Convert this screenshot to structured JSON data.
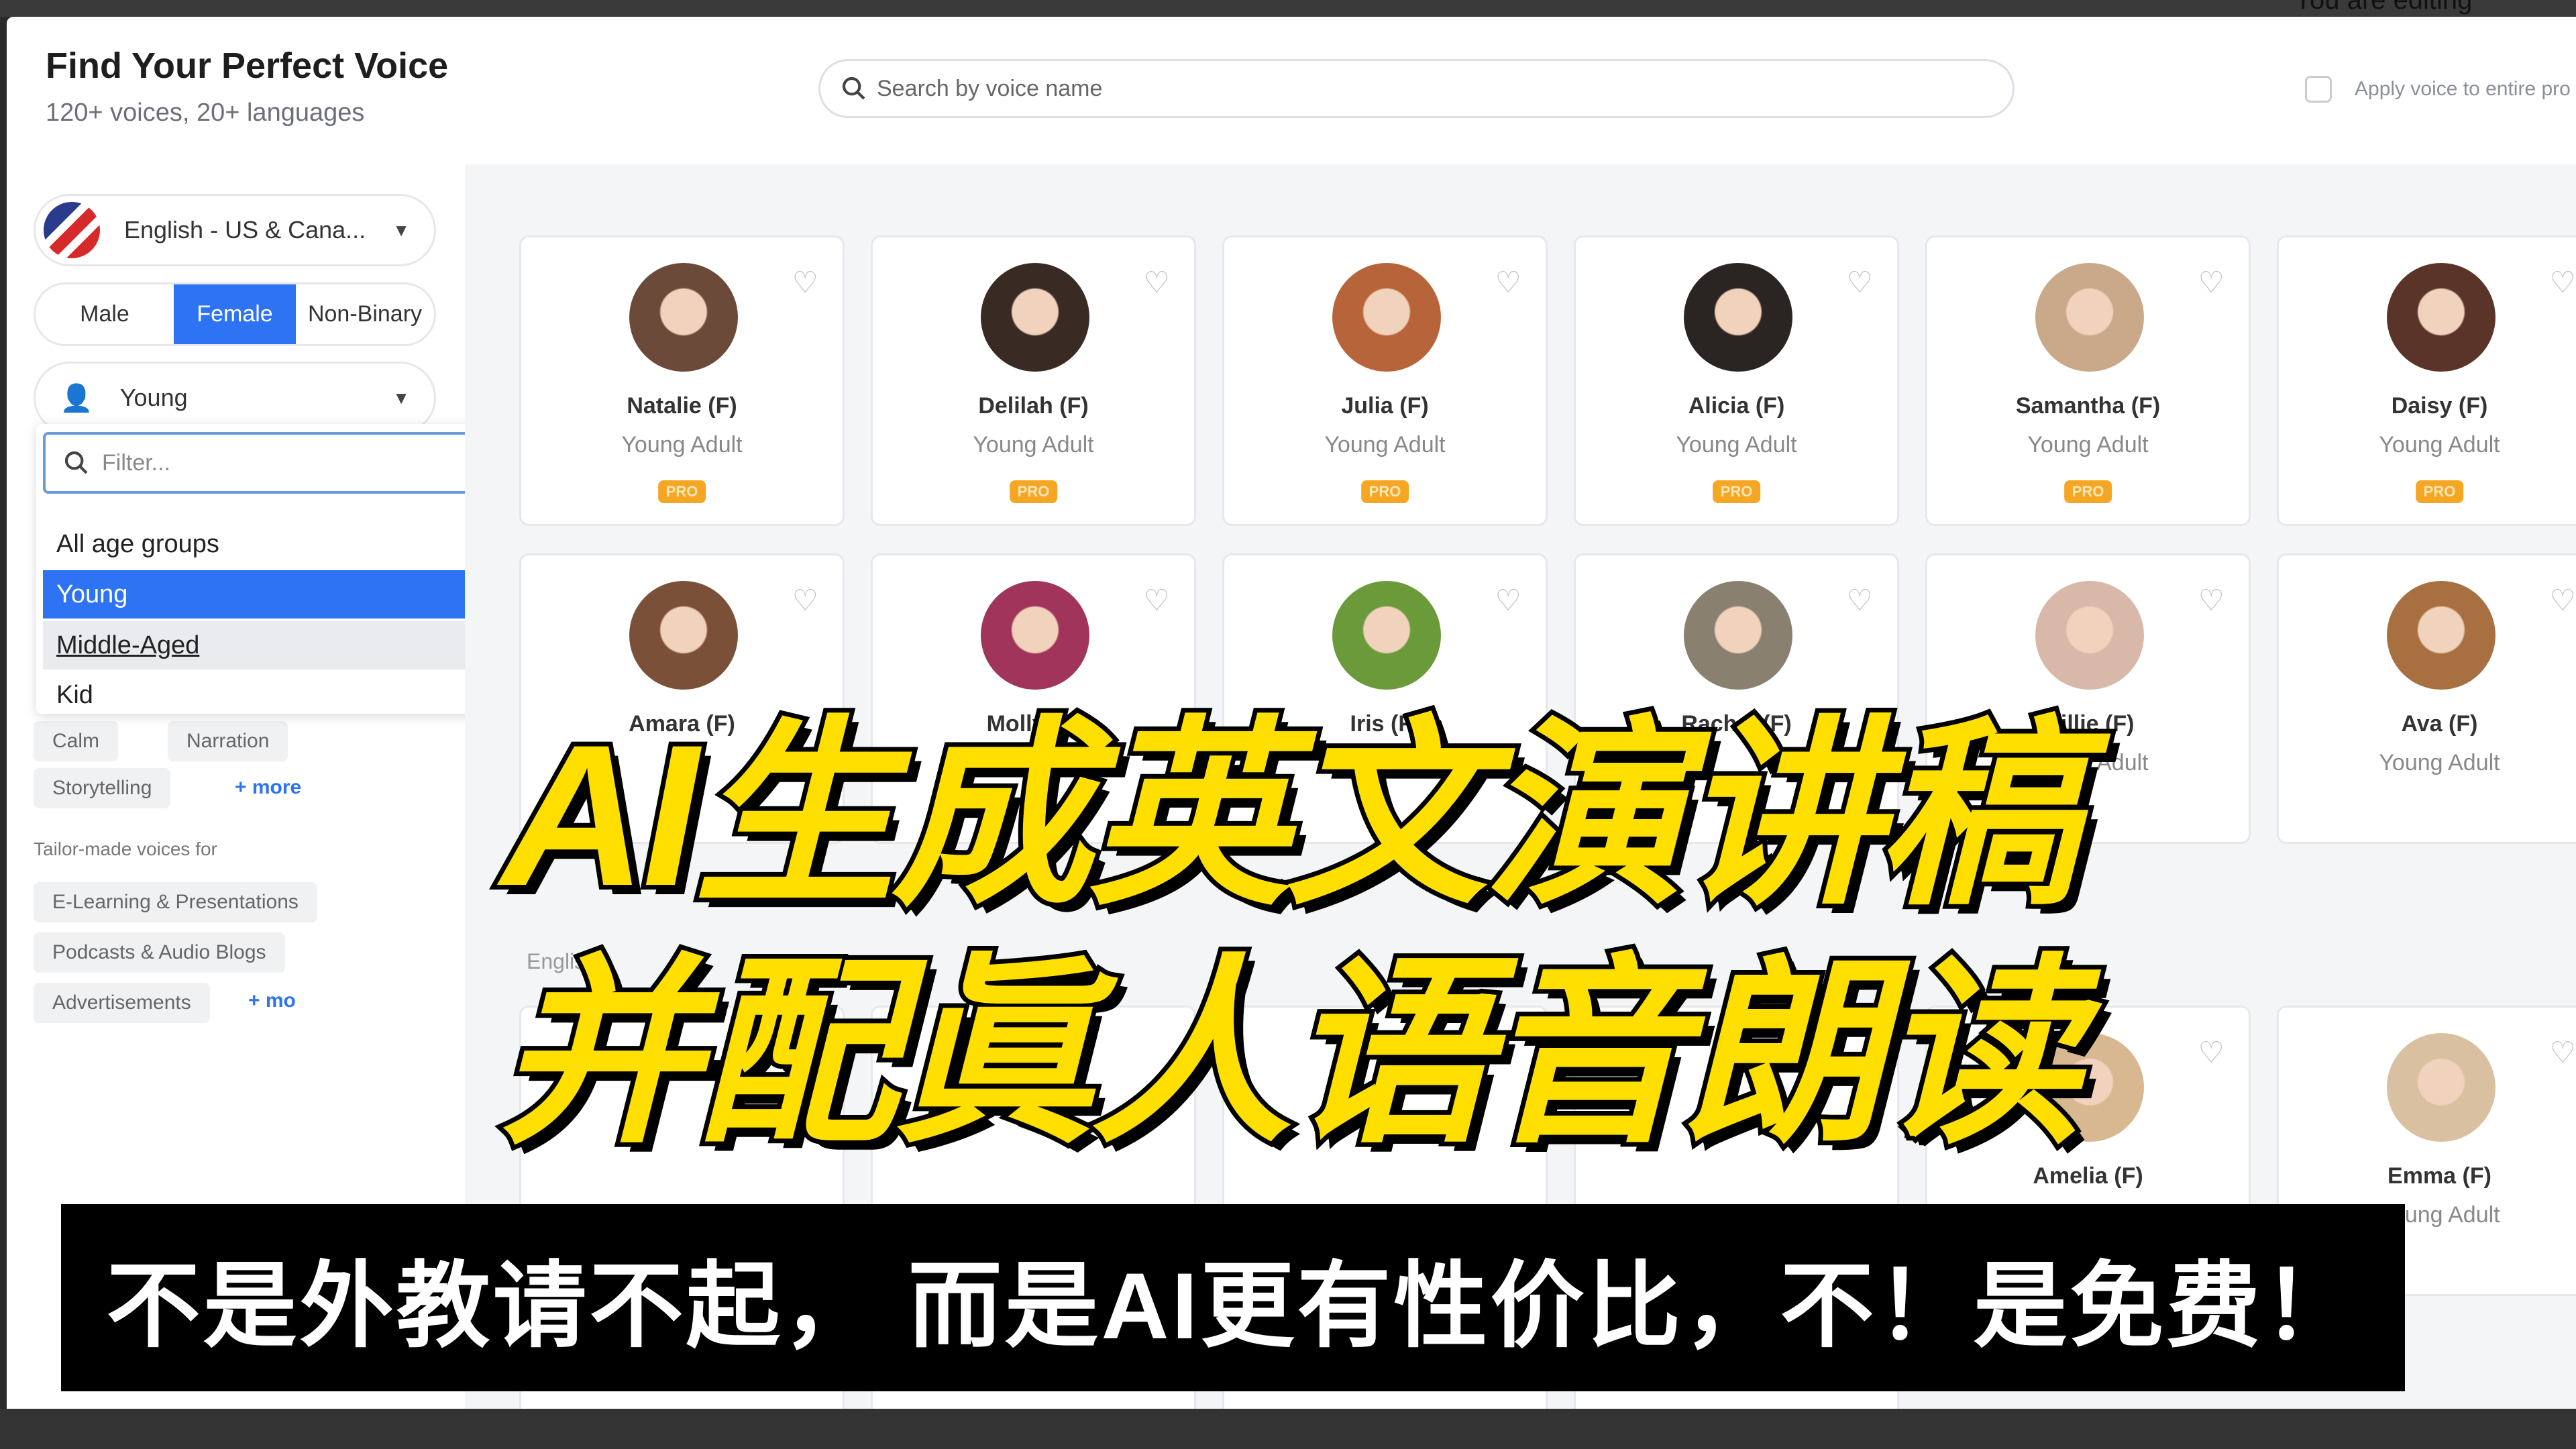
{
  "top_bar": {
    "editing_text": "You are editing"
  },
  "header": {
    "title": "Find Your Perfect Voice",
    "subtitle": "120+ voices, 20+ languages",
    "search_placeholder": "Search by voice name",
    "apply_label": "Apply voice to entire pro"
  },
  "sidebar": {
    "language": "English - US & Cana...",
    "genders": [
      "Male",
      "Female",
      "Non-Binary"
    ],
    "selected_gender": "Female",
    "age": "Young",
    "dropdown": {
      "filter_placeholder": "Filter...",
      "options": [
        "All age groups",
        "Young",
        "Middle-Aged",
        "Kid"
      ],
      "selected": "Young",
      "hovered": "Middle-Aged"
    },
    "style_tags": [
      "Calm",
      "Narration",
      "Storytelling"
    ],
    "style_more": "+ more",
    "section_label": "Tailor-made voices for",
    "use_tags": [
      "E-Learning & Presentations",
      "Podcasts & Audio Blogs",
      "Advertisements"
    ],
    "use_more": "+ mo"
  },
  "voices": [
    {
      "name": "Natalie (F)",
      "age": "Young Adult",
      "pro": "PRO",
      "color": "#6b4a3a"
    },
    {
      "name": "Delilah (F)",
      "age": "Young Adult",
      "pro": "PRO",
      "color": "#3a2a24"
    },
    {
      "name": "Julia (F)",
      "age": "Young Adult",
      "pro": "PRO",
      "color": "#b8643a"
    },
    {
      "name": "Alicia (F)",
      "age": "Young Adult",
      "pro": "PRO",
      "color": "#2a2422"
    },
    {
      "name": "Samantha (F)",
      "age": "Young Adult",
      "pro": "PRO",
      "color": "#c9a98a"
    },
    {
      "name": "Daisy (F)",
      "age": "Young Adult",
      "pro": "PRO",
      "color": "#5a3428"
    },
    {
      "name": "Amara (F)",
      "color": "#7a5038"
    },
    {
      "name": "Molly (F)",
      "color": "#a0345a"
    },
    {
      "name": "Iris (F)",
      "color": "#6a9a3a"
    },
    {
      "name": "Rachel (F)",
      "color": "#8a8070"
    },
    {
      "name": "Millie (F)",
      "age": "Young Adult",
      "color": "#d8b8a8"
    },
    {
      "name": "Ava (F)",
      "age": "Young Adult",
      "color": "#a87040"
    },
    {
      "name": "Amelia (F)",
      "color": "#d8b890"
    },
    {
      "name": "Emma (F)",
      "age": "Young Adult",
      "color": "#d8c0a0"
    }
  ],
  "section_heading": "Englis",
  "overlay": {
    "line1": "AI生成英文演讲稿",
    "line2": "并配眞人语音朗读",
    "caption": "不是外教请不起， 而是AI更有性价比，不！是免费！",
    "title_color": "#ffdf00"
  }
}
